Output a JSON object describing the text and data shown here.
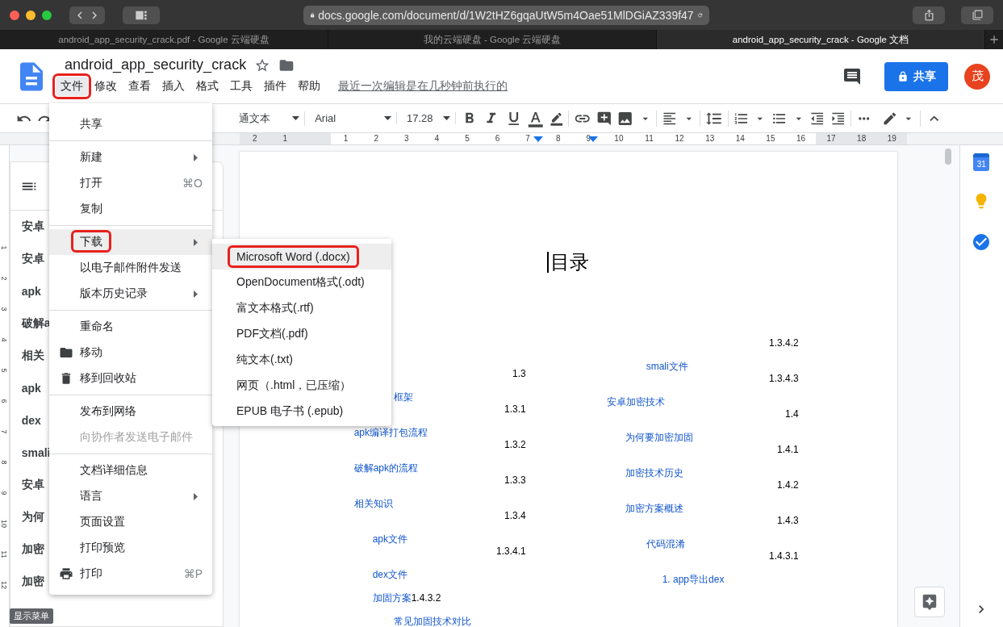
{
  "browser": {
    "url": "docs.google.com/document/d/1W2tHZ6gqaUtW5m4Oae51MlDGiAZ339f47",
    "tabs": [
      {
        "label": "android_app_security_crack.pdf - Google 云端硬盘",
        "selected": false
      },
      {
        "label": "我的云端硬盘 - Google 云端硬盘",
        "selected": false
      },
      {
        "label": "android_app_security_crack - Google 文档",
        "selected": true
      }
    ]
  },
  "doc_header": {
    "title": "android_app_security_crack",
    "share_label": "共享",
    "avatar_letter": "茂",
    "last_edit": "最近一次编辑是在几秒钟前执行的",
    "menus": [
      {
        "label": "文件",
        "selected": true,
        "marked": true
      },
      {
        "label": "修改",
        "selected": false,
        "marked": false
      },
      {
        "label": "查看",
        "selected": false,
        "marked": false
      },
      {
        "label": "插入",
        "selected": false,
        "marked": false
      },
      {
        "label": "格式",
        "selected": false,
        "marked": false
      },
      {
        "label": "工具",
        "selected": false,
        "marked": false
      },
      {
        "label": "插件",
        "selected": false,
        "marked": false
      },
      {
        "label": "帮助",
        "selected": false,
        "marked": false
      }
    ]
  },
  "toolbar": {
    "style": "通文本",
    "font": "Arial",
    "size": "17.28"
  },
  "ruler": {
    "left_margin_ticks": [
      "2",
      "1"
    ],
    "ticks": [
      "1",
      "2",
      "3",
      "4",
      "5",
      "6",
      "7",
      "8",
      "9",
      "10",
      "11",
      "12",
      "13",
      "14",
      "15",
      "16"
    ],
    "right_margin_ticks": [
      "17",
      "18",
      "19"
    ],
    "vertical_ticks": [
      "1",
      "2",
      "3",
      "4",
      "5",
      "6",
      "7",
      "8",
      "9",
      "10",
      "11",
      "12"
    ]
  },
  "outline": {
    "items": [
      "安卓",
      "安卓",
      "apk",
      "破解a",
      "相关",
      "apk",
      "dex",
      "smali",
      "安卓",
      "为何",
      "加密",
      "加密"
    ],
    "tooltip": "显示菜单"
  },
  "file_menu": {
    "groups": [
      [
        {
          "label": "共享",
          "kind": "plain",
          "submenu": false,
          "disabled": false,
          "selected": false,
          "marked": false
        }
      ],
      [
        {
          "label": "新建",
          "kind": "plain",
          "submenu": true,
          "disabled": false,
          "selected": false,
          "marked": false
        },
        {
          "label": "打开",
          "shortcut": "⌘O",
          "kind": "plain",
          "submenu": false,
          "disabled": false,
          "selected": false,
          "marked": false
        },
        {
          "label": "复制",
          "kind": "plain",
          "submenu": false,
          "disabled": false,
          "selected": false,
          "marked": false
        }
      ],
      [
        {
          "label": "下载",
          "kind": "plain",
          "submenu": true,
          "disabled": false,
          "selected": true,
          "marked": true
        },
        {
          "label": "以电子邮件附件发送",
          "kind": "plain",
          "submenu": false,
          "disabled": false,
          "selected": false,
          "marked": false
        },
        {
          "label": "版本历史记录",
          "kind": "plain",
          "submenu": true,
          "disabled": false,
          "selected": false,
          "marked": false
        }
      ],
      [
        {
          "label": "重命名",
          "kind": "plain",
          "submenu": false,
          "disabled": false,
          "selected": false,
          "marked": false
        },
        {
          "label": "移动",
          "kind": "folder",
          "submenu": false,
          "disabled": false,
          "selected": false,
          "marked": false
        },
        {
          "label": "移到回收站",
          "kind": "trash",
          "submenu": false,
          "disabled": false,
          "selected": false,
          "marked": false
        }
      ],
      [
        {
          "label": "发布到网络",
          "kind": "plain",
          "submenu": false,
          "disabled": false,
          "selected": false,
          "marked": false
        },
        {
          "label": "向协作者发送电子邮件",
          "kind": "plain",
          "submenu": false,
          "disabled": true,
          "selected": false,
          "marked": false
        }
      ],
      [
        {
          "label": "文档详细信息",
          "kind": "plain",
          "submenu": false,
          "disabled": false,
          "selected": false,
          "marked": false
        },
        {
          "label": "语言",
          "kind": "plain",
          "submenu": true,
          "disabled": false,
          "selected": false,
          "marked": false
        },
        {
          "label": "页面设置",
          "kind": "plain",
          "submenu": false,
          "disabled": false,
          "selected": false,
          "marked": false
        },
        {
          "label": "打印预览",
          "kind": "plain",
          "submenu": false,
          "disabled": false,
          "selected": false,
          "marked": false
        },
        {
          "label": "打印",
          "shortcut": "⌘P",
          "kind": "printer",
          "submenu": false,
          "disabled": false,
          "selected": false,
          "marked": false
        }
      ]
    ]
  },
  "download_menu": {
    "items": [
      {
        "label": "Microsoft Word (.docx)",
        "selected": true,
        "marked": true
      },
      {
        "label": "OpenDocument格式(.odt)",
        "selected": false,
        "marked": false
      },
      {
        "label": "富文本格式(.rtf)",
        "selected": false,
        "marked": false
      },
      {
        "label": "PDF文档(.pdf)",
        "selected": false,
        "marked": false
      },
      {
        "label": "纯文本(.txt)",
        "selected": false,
        "marked": false
      },
      {
        "label": "网页（.html，已压缩）",
        "selected": false,
        "marked": false
      },
      {
        "label": "EPUB 电子书 (.epub)",
        "selected": false,
        "marked": false
      }
    ]
  },
  "document": {
    "heading": "目录",
    "toc_left": [
      {
        "kind": "number",
        "text": "1.3"
      },
      {
        "kind": "h3",
        "text": "框架"
      },
      {
        "kind": "number",
        "text": "1.3.1"
      },
      {
        "kind": "h1",
        "text": "apk编译打包流程"
      },
      {
        "kind": "number",
        "text": "1.3.2"
      },
      {
        "kind": "h1",
        "text": "破解apk的流程"
      },
      {
        "kind": "number",
        "text": "1.3.3"
      },
      {
        "kind": "h1",
        "text": "相关知识"
      },
      {
        "kind": "number",
        "text": "1.3.4"
      },
      {
        "kind": "h2",
        "text": "apk文件"
      },
      {
        "kind": "number",
        "text": "1.3.4.1"
      },
      {
        "kind": "h2",
        "text": "dex文件"
      },
      {
        "kind": "h2",
        "text": "加固方案",
        "suffix": "1.4.3.2"
      },
      {
        "kind": "h3",
        "text": "常见加固技术对比"
      }
    ],
    "toc_right": [
      {
        "kind": "number",
        "text": "1.3.4.2"
      },
      {
        "kind": "h3",
        "text": "smali文件"
      },
      {
        "kind": "number",
        "text": "1.3.4.3"
      },
      {
        "kind": "h1",
        "text": "安卓加密技术"
      },
      {
        "kind": "number",
        "text": "1.4"
      },
      {
        "kind": "h2",
        "text": "为何要加密加固"
      },
      {
        "kind": "number",
        "text": "1.4.1"
      },
      {
        "kind": "h2",
        "text": "加密技术历史"
      },
      {
        "kind": "number",
        "text": "1.4.2"
      },
      {
        "kind": "h2",
        "text": "加密方案概述"
      },
      {
        "kind": "number",
        "text": "1.4.3"
      },
      {
        "kind": "h3",
        "text": "代码混淆"
      },
      {
        "kind": "number",
        "text": "1.4.3.1"
      },
      {
        "kind": "h4",
        "text": "1. app导出dex"
      }
    ]
  },
  "side_panel": {
    "calendar_day": "31"
  }
}
